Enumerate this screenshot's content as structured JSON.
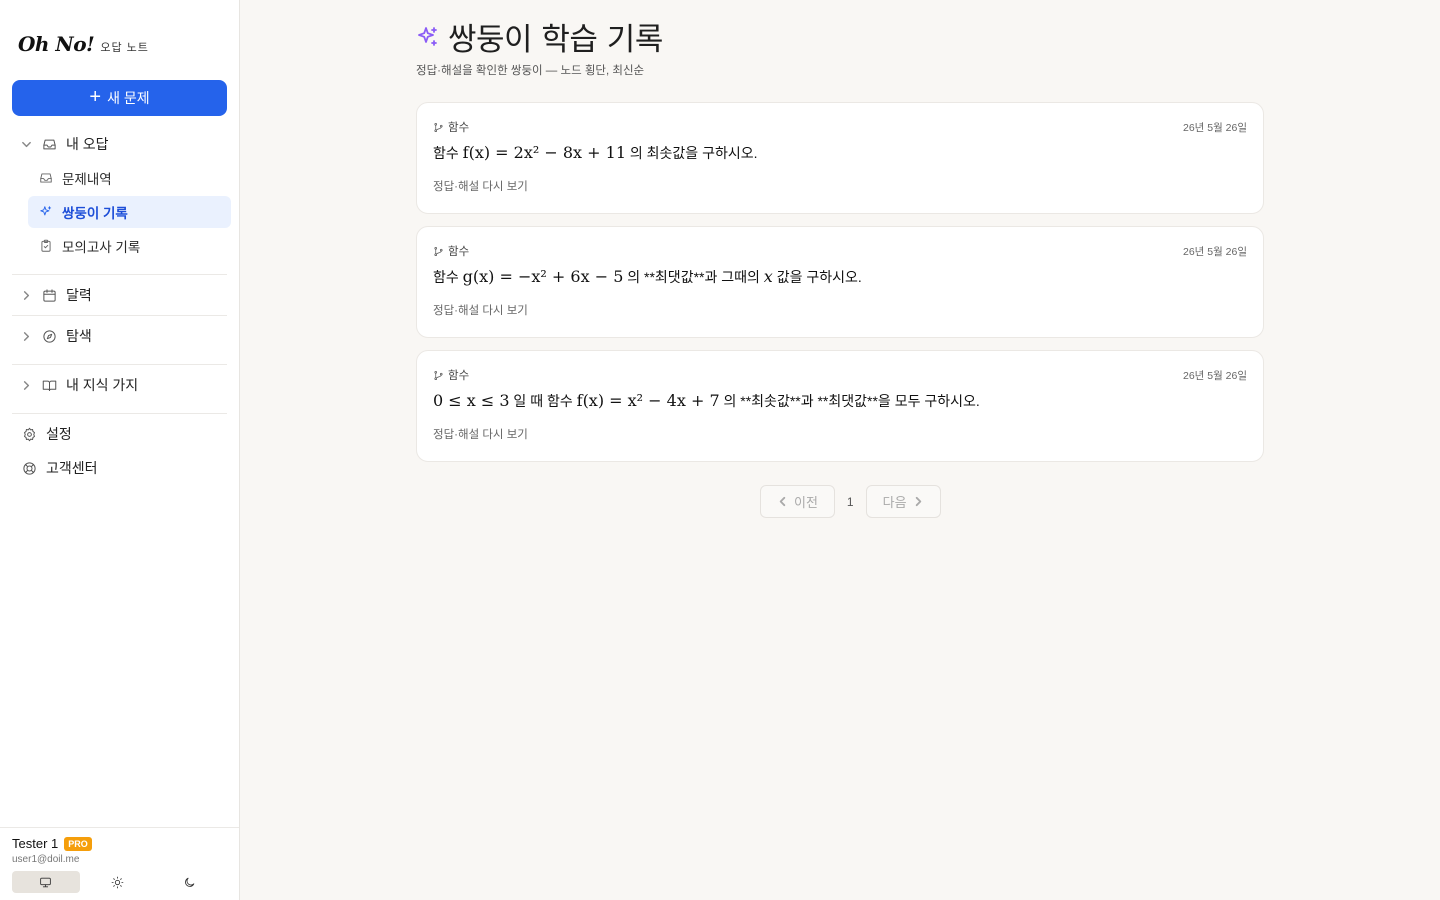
{
  "brand": {
    "logo": "Oh No!",
    "subtitle": "오답 노트"
  },
  "sidebar": {
    "new_button": "새 문제",
    "my_wrong": "내 오답",
    "sub_items": [
      "문제내역",
      "쌍둥이 기록",
      "모의고사 기록"
    ],
    "calendar": "달력",
    "explore": "탐색",
    "knowledge": "내 지식 가지",
    "settings": "설정",
    "support": "고객센터"
  },
  "user": {
    "name": "Tester 1",
    "badge": "PRO",
    "email": "user1@doil.me"
  },
  "page": {
    "title": "쌍둥이 학습 기록",
    "subtitle": "정답·해설을 확인한 쌍둥이 — 노드 횡단, 최신순"
  },
  "cards": [
    {
      "tag": "함수",
      "date": "26년 5월 26일",
      "pre": "함수 ",
      "math": "f(x) = 2x² − 8x + 11",
      "post": " 의 최솟값을 구하시오.",
      "math2": "",
      "post2": "",
      "review": "정답·해설 다시 보기"
    },
    {
      "tag": "함수",
      "date": "26년 5월 26일",
      "pre": "함수 ",
      "math": "g(x) = −x² + 6x − 5",
      "post": " 의 **최댓값**과 그때의 ",
      "math2": "x",
      "post2": " 값을 구하시오.",
      "review": "정답·해설 다시 보기"
    },
    {
      "tag": "함수",
      "date": "26년 5월 26일",
      "pre": "",
      "math": "0 ≤ x ≤ 3",
      "post": " 일 때 함수 ",
      "math2": "f(x) = x² − 4x + 7",
      "post2": " 의 **최솟값**과 **최댓값**을 모두 구하시오.",
      "review": "정답·해설 다시 보기"
    }
  ],
  "pagination": {
    "prev": "이전",
    "page": "1",
    "next": "다음"
  }
}
